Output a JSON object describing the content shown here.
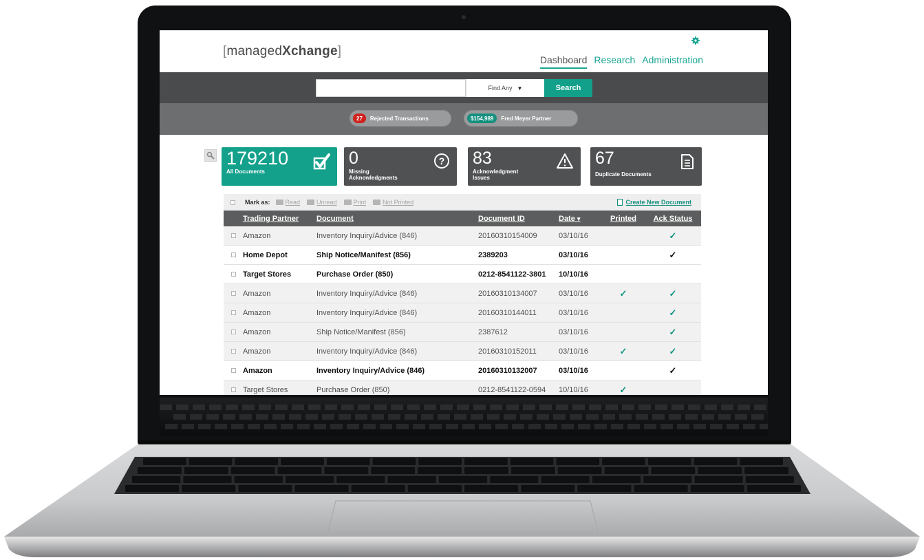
{
  "app": {
    "logo_name": "managedXchange",
    "logo_prefix": "managed",
    "logo_suffix": "Xchange",
    "logo_open": "[",
    "logo_close": "]",
    "settings_icon": "gear-icon"
  },
  "nav": {
    "items": [
      {
        "label": "Dashboard",
        "active": true
      },
      {
        "label": "Research",
        "active": false
      },
      {
        "label": "Administration",
        "active": false
      }
    ]
  },
  "search": {
    "value": "",
    "scope": "Find Any",
    "button": "Search"
  },
  "alerts": {
    "rejected": {
      "count": "27",
      "label": "Rejected Transactions"
    },
    "partner": {
      "amount": "$154,989",
      "label": "Fred Meyer Partner"
    }
  },
  "tiles": [
    {
      "value": "179210",
      "label": "All Documents",
      "icon": "check-icon"
    },
    {
      "value": "0",
      "label_line1": "Missing",
      "label_line2": "Acknowledgments",
      "icon": "question-icon"
    },
    {
      "value": "83",
      "label_line1": "Acknowledgment",
      "label_line2": "Issues",
      "icon": "warning-icon"
    },
    {
      "value": "67",
      "label": "Duplicate Documents",
      "icon": "document-icon"
    }
  ],
  "toolbar": {
    "mark_as": "Mark as:",
    "read": "Read",
    "unread": "Unread",
    "print": "Print",
    "not_printed": "Not Printed",
    "create_new": "Create New Document"
  },
  "table": {
    "headers": {
      "trading_partner": "Trading Partner",
      "document": "Document",
      "document_id": "Document ID",
      "date": "Date",
      "date_sort": "▾",
      "printed": "Printed",
      "ack_status": "Ack Status"
    },
    "check_glyph": "✓",
    "rows": [
      {
        "partner": "Amazon",
        "document": "Inventory Inquiry/Advice (846)",
        "doc_id": "20160310154009",
        "date": "03/10/16",
        "printed": false,
        "ack": true,
        "unread": false
      },
      {
        "partner": "Home Depot",
        "document": "Ship Notice/Manifest (856)",
        "doc_id": "2389203",
        "date": "03/10/16",
        "printed": false,
        "ack": true,
        "unread": true
      },
      {
        "partner": "Target Stores",
        "document": "Purchase Order (850)",
        "doc_id": "0212-8541122-3801",
        "date": "10/10/16",
        "printed": false,
        "ack": false,
        "unread": true
      },
      {
        "partner": "Amazon",
        "document": "Inventory Inquiry/Advice (846)",
        "doc_id": "20160310134007",
        "date": "03/10/16",
        "printed": true,
        "ack": true,
        "unread": false
      },
      {
        "partner": "Amazon",
        "document": "Inventory Inquiry/Advice (846)",
        "doc_id": "20160310144011",
        "date": "03/10/16",
        "printed": false,
        "ack": true,
        "unread": false
      },
      {
        "partner": "Amazon",
        "document": "Ship Notice/Manifest (856)",
        "doc_id": "2387612",
        "date": "03/10/16",
        "printed": false,
        "ack": true,
        "unread": false
      },
      {
        "partner": "Amazon",
        "document": "Inventory Inquiry/Advice (846)",
        "doc_id": "20160310152011",
        "date": "03/10/16",
        "printed": true,
        "ack": true,
        "unread": false
      },
      {
        "partner": "Amazon",
        "document": "Inventory Inquiry/Advice (846)",
        "doc_id": "20160310132007",
        "date": "03/10/16",
        "printed": false,
        "ack": true,
        "unread": true
      },
      {
        "partner": "Target Stores",
        "document": "Purchase Order (850)",
        "doc_id": "0212-8541122-0594",
        "date": "10/10/16",
        "printed": true,
        "ack": false,
        "unread": false
      }
    ]
  },
  "colors": {
    "brand_teal": "#13a18c",
    "dark_bar": "#4a4b4c",
    "alert_bar": "#6d6e6f",
    "reject_red": "#d0211c",
    "tile_gray": "#505152"
  }
}
